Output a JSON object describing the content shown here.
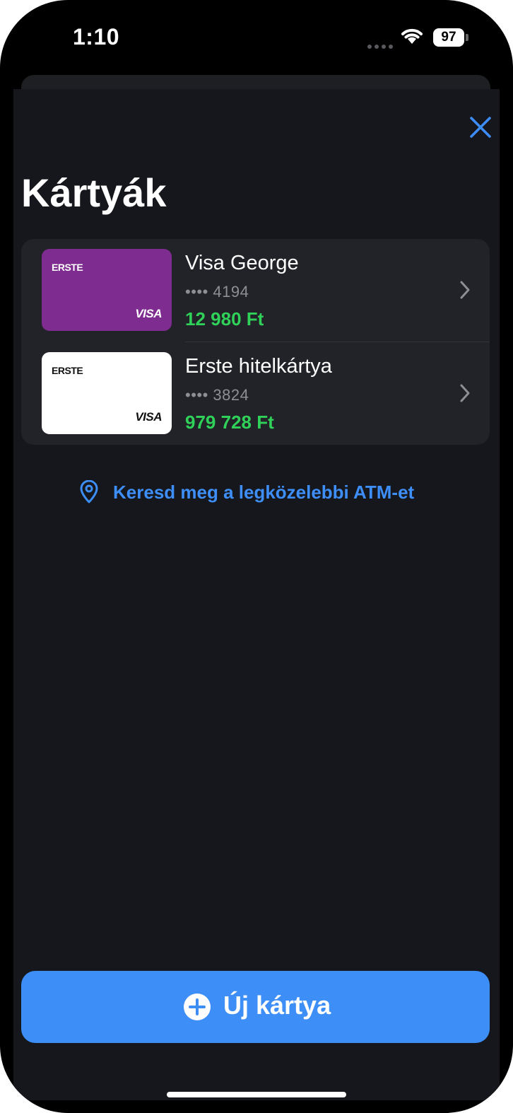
{
  "status_bar": {
    "time": "1:10",
    "battery": "97"
  },
  "header": {
    "title": "Kártyák",
    "close_icon": "close-icon"
  },
  "cards": [
    {
      "brand": "ERSTE",
      "network": "VISA",
      "name": "Visa George",
      "number": "•••• 4194",
      "balance": "12 980 Ft",
      "color": "#7f2c90"
    },
    {
      "brand": "ERSTE",
      "network": "VISA",
      "name": "Erste hitelkártya",
      "number": "•••• 3824",
      "balance": "979 728 Ft",
      "color": "#ffffff"
    }
  ],
  "atm_link": {
    "label": "Keresd meg a legközelebbi ATM-et",
    "icon": "location-pin-icon"
  },
  "new_card_button": {
    "label": "Új kártya",
    "icon": "plus-circle-icon"
  },
  "colors": {
    "accent": "#3d8ef7",
    "positive": "#30d158",
    "background": "#16171c"
  }
}
